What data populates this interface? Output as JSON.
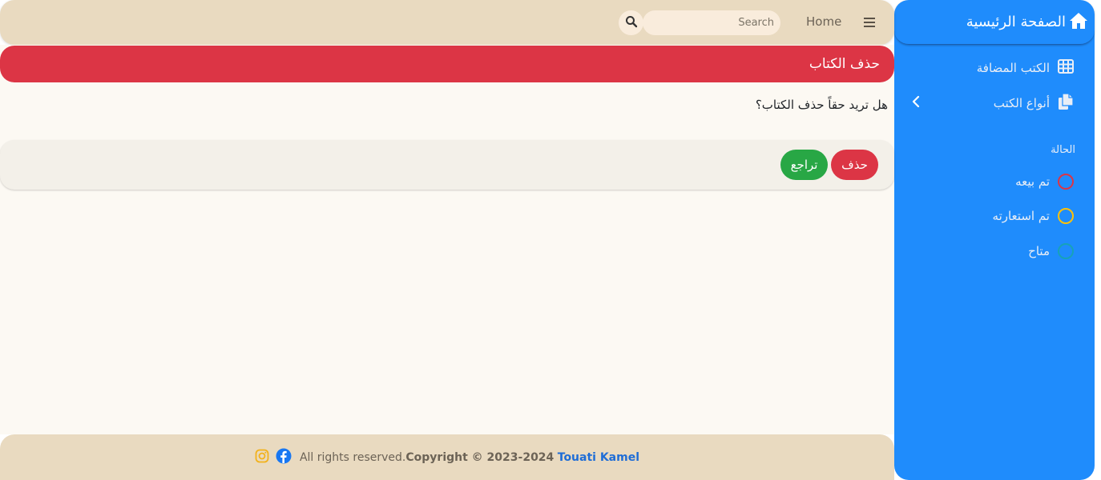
{
  "sidebar": {
    "brand": "الصفحة الرئيسية",
    "nav_items": [
      {
        "label": "الكتب المضافة",
        "icon": "table-icon"
      },
      {
        "label": "أنواع الكتب",
        "icon": "copy-icon"
      }
    ],
    "section_label": "الحالة",
    "status_items": [
      {
        "label": "تم بيعه",
        "color": "#dc3545"
      },
      {
        "label": "تم استعارته",
        "color": "#ffc107"
      },
      {
        "label": "متاح",
        "color": "#17a2b8"
      }
    ],
    "bg_color": "#1f8cfc"
  },
  "navbar": {
    "home": "Home",
    "search_placeholder": "Search"
  },
  "card": {
    "title": "حذف الكتاب",
    "question": "هل تريد حقاً حذف الكتاب؟",
    "delete_button": "حذف",
    "cancel_button": "تراجع"
  },
  "footer": {
    "author": "Touati Kamel",
    "copyright": "Copyright © 2023-2024",
    "rights": "All rights reserved."
  },
  "colors": {
    "danger": "#dc3545",
    "success": "#28a745",
    "navbar_bg": "#e9dac0"
  }
}
